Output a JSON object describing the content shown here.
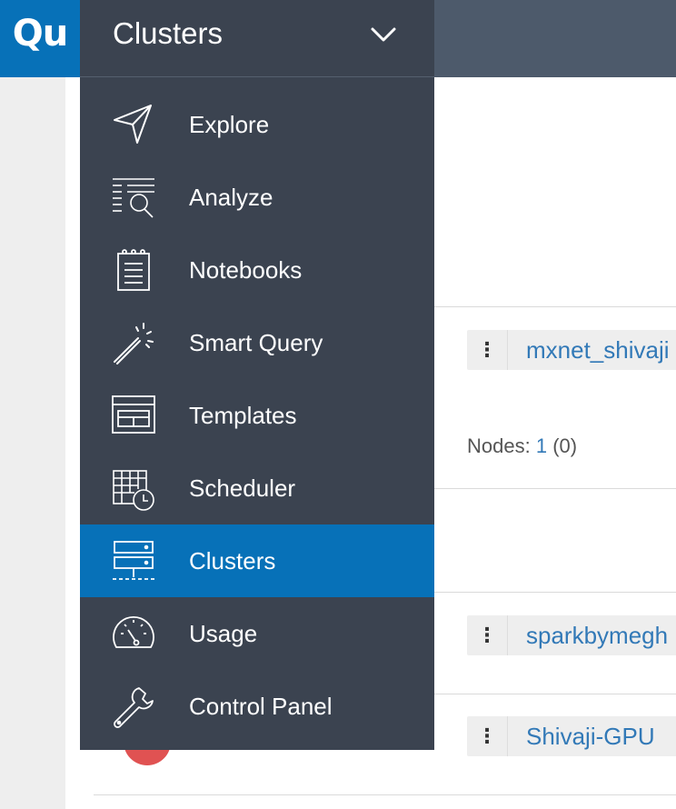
{
  "app": {
    "logo_text": "Qu"
  },
  "nav": {
    "current": "Clusters",
    "items": [
      {
        "label": "Explore",
        "icon": "paper-plane-icon",
        "active": false
      },
      {
        "label": "Analyze",
        "icon": "analyze-icon",
        "active": false
      },
      {
        "label": "Notebooks",
        "icon": "notebook-icon",
        "active": false
      },
      {
        "label": "Smart Query",
        "icon": "magic-wand-icon",
        "active": false
      },
      {
        "label": "Templates",
        "icon": "templates-icon",
        "active": false
      },
      {
        "label": "Scheduler",
        "icon": "scheduler-icon",
        "active": false
      },
      {
        "label": "Clusters",
        "icon": "clusters-icon",
        "active": true
      },
      {
        "label": "Usage",
        "icon": "gauge-icon",
        "active": false
      },
      {
        "label": "Control Panel",
        "icon": "wrench-icon",
        "active": false
      }
    ]
  },
  "clusters": [
    {
      "name": "mxnet_shivaji",
      "nodes_label": "Nodes:",
      "nodes_count": "1",
      "nodes_extra": "(0)"
    },
    {
      "name": "sparkbymegh"
    },
    {
      "name": "Shivaji-GPU"
    }
  ],
  "colors": {
    "topbar": "#4d5a6b",
    "menu_bg": "#3b4350",
    "accent": "#0771b8",
    "link": "#3279b7"
  }
}
